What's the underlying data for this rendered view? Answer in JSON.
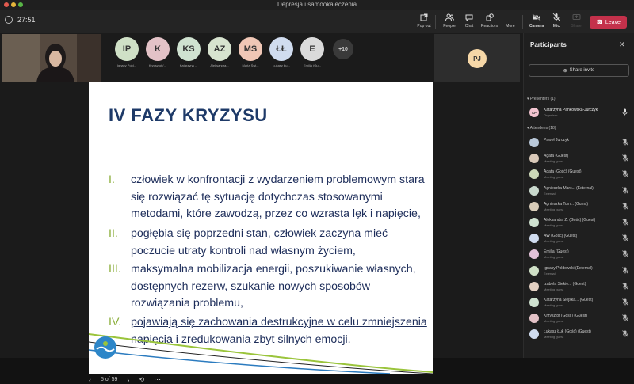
{
  "window": {
    "title": "Depresja i samookaleczenia"
  },
  "toolbar": {
    "timer": "27:51",
    "buttons": [
      {
        "label": "Pop out"
      },
      {
        "label": "People"
      },
      {
        "label": "Chat"
      },
      {
        "label": "Reactions"
      },
      {
        "label": "More"
      },
      {
        "label": "Camera"
      },
      {
        "label": "Mic"
      },
      {
        "label": "Share"
      }
    ],
    "leave_label": "Leave"
  },
  "gallery": {
    "avatars": [
      {
        "initials": "IP",
        "name": "Ignacy Pold...",
        "color": "#cfe0c6"
      },
      {
        "initials": "K",
        "name": "Krzysztof (...",
        "color": "#e3c2c7"
      },
      {
        "initials": "KS",
        "name": "Katarzyna ...",
        "color": "#cfe2d0"
      },
      {
        "initials": "AZ",
        "name": "Aleksandra...",
        "color": "#d7e3cf"
      },
      {
        "initials": "MŚ",
        "name": "Maria Świ...",
        "color": "#f0c7b6"
      },
      {
        "initials": "ŁŁ",
        "name": "Łukasz Łu...",
        "color": "#d0dcef"
      },
      {
        "initials": "E",
        "name": "Emilia (Gu...",
        "color": "#dadada"
      },
      {
        "initials": "+10",
        "name": "",
        "color": "#3a3a3a"
      }
    ],
    "pj": {
      "initials": "PJ"
    }
  },
  "slide": {
    "heading": "IV FAZY KRYZYSU",
    "items": [
      {
        "num": "I.",
        "text": "człowiek w konfrontacji z wydarzeniem problemowym stara się rozwiązać tę sytuację dotychczas stosowanymi metodami, które zawodzą, przez co wzrasta lęk i napięcie,"
      },
      {
        "num": "II.",
        "text": "pogłębia się poprzedni stan, człowiek zaczyna mieć poczucie utraty kontroli nad własnym życiem,"
      },
      {
        "num": "III.",
        "text": "maksymalna mobilizacja energii, poszukiwanie własnych, dostępnych rezerw, szukanie nowych sposobów rozwiązania problemu,"
      },
      {
        "num": "IV.",
        "text": "pojawiają się zachowania destrukcyjne w celu zmniejszenia napięcia i zredukowania zbyt silnych emocji."
      }
    ],
    "page_indicator": "5 of 59"
  },
  "panel": {
    "title": "Participants",
    "share_invite": "Share invite",
    "presenters_header": "Presenters (1)",
    "attendees_header": "Attendees (18)",
    "presenters": [
      {
        "initials": "KP",
        "name": "Katarzyna Pankowska-Jurczyk",
        "role": "Organiser",
        "color": "#f2c4d0"
      }
    ],
    "attendees": [
      {
        "initials": "",
        "name": "Paweł Jurczyk",
        "role": "",
        "color": "#b9c8d9"
      },
      {
        "initials": "",
        "name": "Agata (Guest)",
        "role": "Meeting guest",
        "color": "#d9c9b9"
      },
      {
        "initials": "",
        "name": "Agata (Gość) (Guest)",
        "role": "Meeting guest",
        "color": "#cdd9b9"
      },
      {
        "initials": "",
        "name": "Agnieszka Marc... (External)",
        "role": "External",
        "color": "#c9d9cd"
      },
      {
        "initials": "",
        "name": "Agnieszka Tom... (Guest)",
        "role": "Meeting guest",
        "color": "#d9cdb9"
      },
      {
        "initials": "",
        "name": "Aleksandra Z. (Gość) (Guest)",
        "role": "Meeting guest",
        "color": "#cfe2d0"
      },
      {
        "initials": "",
        "name": "AW (Gość) (Guest)",
        "role": "Meeting guest",
        "color": "#d0dcef"
      },
      {
        "initials": "",
        "name": "Emilia (Guest)",
        "role": "Meeting guest",
        "color": "#e3c2d9"
      },
      {
        "initials": "",
        "name": "Ignacy Poldowski (External)",
        "role": "External",
        "color": "#cfe0c6"
      },
      {
        "initials": "",
        "name": "Izabela Siekie... (Guest)",
        "role": "Meeting guest",
        "color": "#e3d0c2"
      },
      {
        "initials": "",
        "name": "Katarzyna Siejska... (Guest)",
        "role": "Meeting guest",
        "color": "#cfe2d0"
      },
      {
        "initials": "",
        "name": "Krzysztof (Gość) (Guest)",
        "role": "Meeting guest",
        "color": "#e3c2c7"
      },
      {
        "initials": "",
        "name": "Łukasz Łuk (Gość) (Guest)",
        "role": "Meeting guest",
        "color": "#d0dcef"
      }
    ]
  }
}
